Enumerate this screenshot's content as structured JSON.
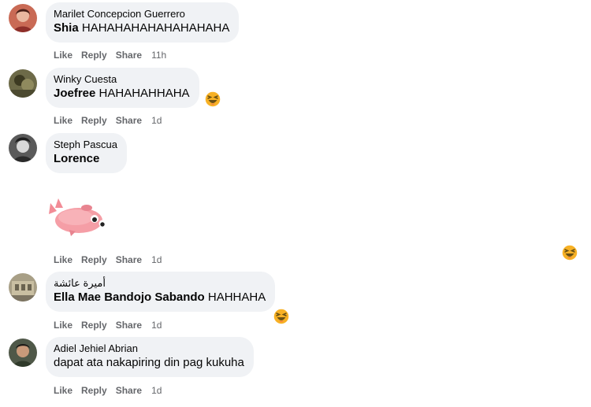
{
  "comments": [
    {
      "author": "Marilet Concepcion Guerrero",
      "mention": "Shia",
      "text": " HAHAHAHAHAHAHAHAHA",
      "like": "Like",
      "reply": "Reply",
      "share": "Share",
      "time": "11h"
    },
    {
      "author": "Winky Cuesta",
      "mention": "Joefree",
      "text": " HAHAHAHHAHA",
      "like": "Like",
      "reply": "Reply",
      "share": "Share",
      "time": "1d"
    },
    {
      "author": "Steph Pascua",
      "mention": "Lorence",
      "text": "",
      "like": "Like",
      "reply": "Reply",
      "share": "Share",
      "time": "1d"
    },
    {
      "author": "أميرة عائشة",
      "mention": "Ella Mae Bandojo Sabando",
      "text": " HAHHAHA",
      "like": "Like",
      "reply": "Reply",
      "share": "Share",
      "time": "1d"
    },
    {
      "author": "Adiel Jehiel Abrian",
      "mention": "",
      "text": "dapat ata nakapiring din pag kukuha",
      "like": "Like",
      "reply": "Reply",
      "share": "Share",
      "time": "1d"
    }
  ],
  "reaction_icon": "laughing-emoji-icon",
  "sticker_icon": "pink-pig-sticker",
  "colors": {
    "bubble": "#f0f2f5",
    "action_text": "#65676b",
    "emoji_face": "#f7b125",
    "emoji_mouth": "#695014"
  }
}
